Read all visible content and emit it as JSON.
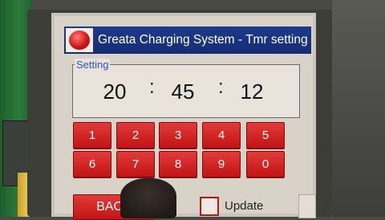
{
  "titlebar": {
    "title": "Greata Charging System - Tmr setting",
    "logo_icon": "red-ball-icon"
  },
  "setting": {
    "label": "Setting",
    "hours": "20",
    "minutes": "45",
    "seconds": "12",
    "separator": ":"
  },
  "keypad": {
    "keys": [
      "1",
      "2",
      "3",
      "4",
      "5",
      "6",
      "7",
      "8",
      "9",
      "0"
    ]
  },
  "controls": {
    "back_label": "BACK",
    "update_label": "Update",
    "update_checked": false
  },
  "colors": {
    "titlebar": "#1e3a8a",
    "key": "#d21e1e",
    "screen": "#d9d2c9",
    "setting_label": "#2a55c9"
  }
}
